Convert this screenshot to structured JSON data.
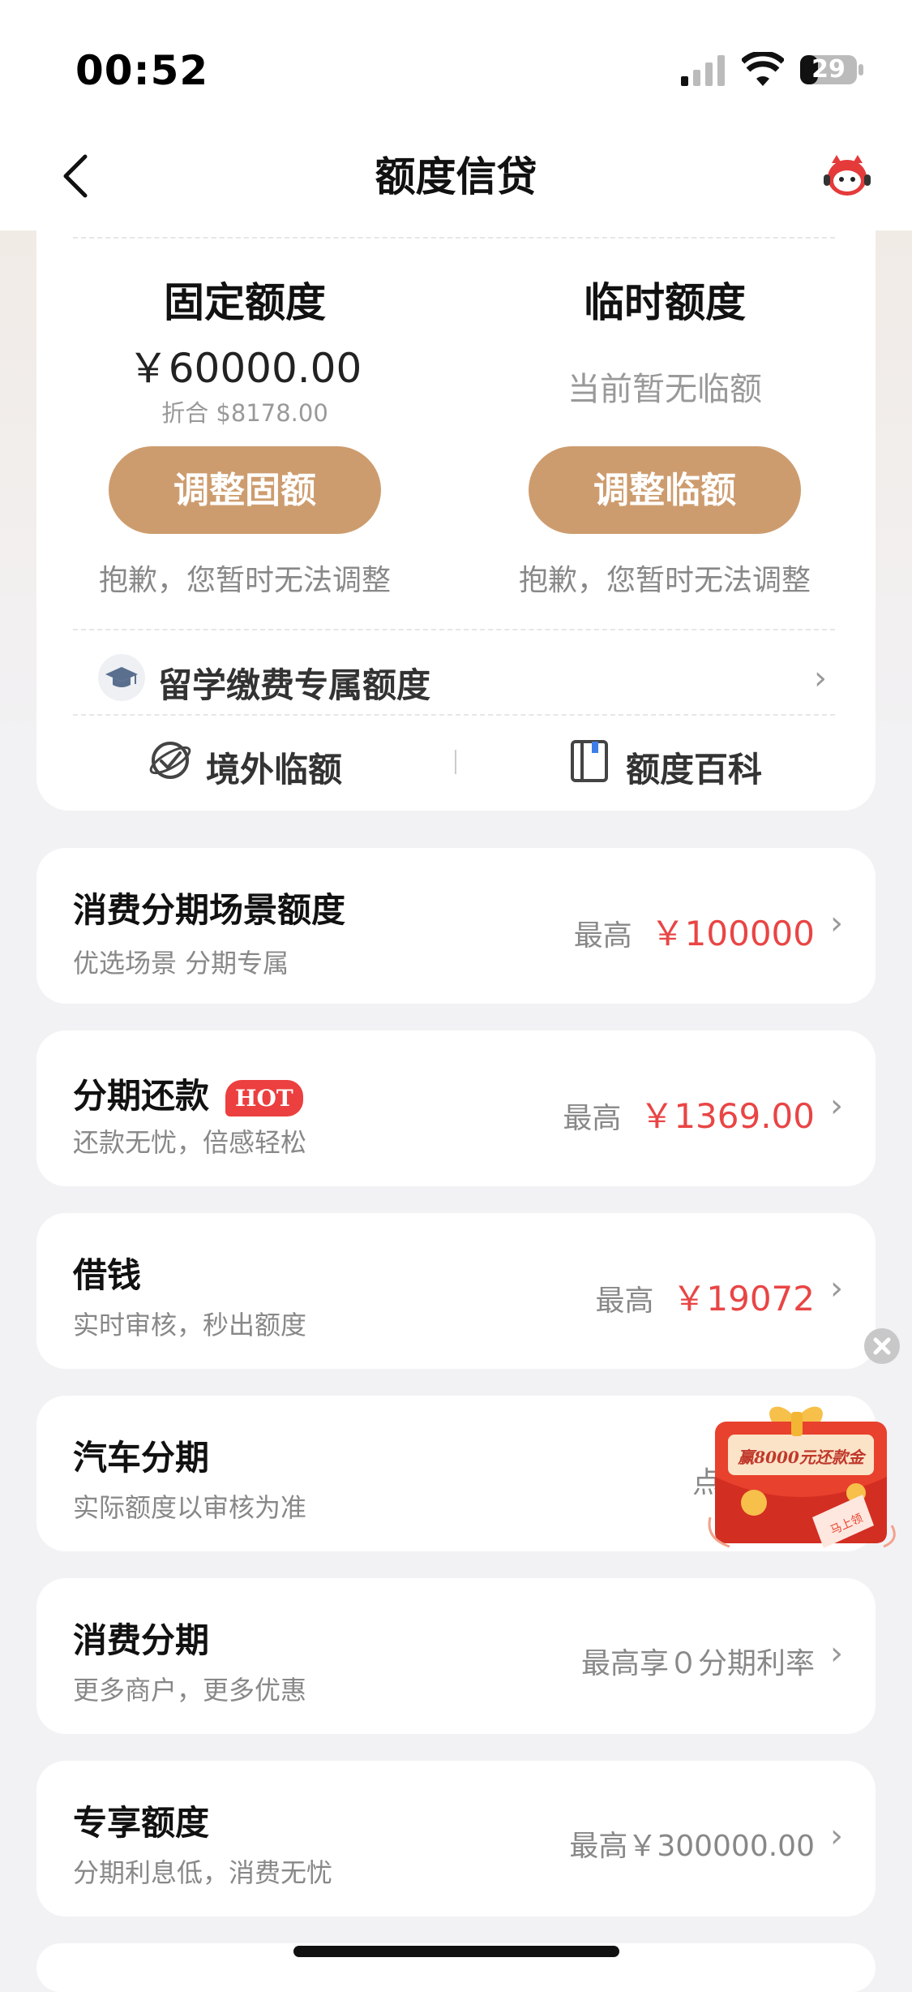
{
  "status": {
    "time": "00:52",
    "battery": "29"
  },
  "nav": {
    "title": "额度信贷",
    "back_icon": "chevron-left-icon",
    "assistant_icon": "mascot-icon"
  },
  "fixed": {
    "title": "固定额度",
    "amount": "￥60000.00",
    "converted": "折合 $8178.00",
    "button": "调整固额",
    "note": "抱歉，您暂时无法调整"
  },
  "temporary": {
    "title": "临时额度",
    "status": "当前暂无临额",
    "button": "调整临额",
    "note": "抱歉，您暂时无法调整"
  },
  "study": {
    "label": "留学缴费专属额度"
  },
  "links": {
    "overseas": "境外临额",
    "encyclopedia": "额度百科"
  },
  "cards": [
    {
      "title": "消费分期场景额度",
      "subtitle": "优选场景 分期专属",
      "prefix": "最高",
      "value": "￥100000"
    },
    {
      "title": "分期还款",
      "badge": "HOT",
      "subtitle": "还款无忧，倍感轻松",
      "prefix": "最高",
      "value": "￥1369.00"
    },
    {
      "title": "借钱",
      "subtitle": "实时审核，秒出额度",
      "prefix": "最高",
      "value": "￥19072"
    },
    {
      "title": "汽车分期",
      "subtitle": "实际额度以审核为准",
      "prefix": "点",
      "value": ""
    },
    {
      "title": "消费分期",
      "subtitle": "更多商户，更多优惠",
      "prefix": "最高享０分期利率",
      "value": ""
    },
    {
      "title": "专享额度",
      "subtitle": "分期利息低，消费无忧",
      "prefix": "最高￥300000.00",
      "value": ""
    }
  ],
  "promo": {
    "text": "赢8000元还款金",
    "tag": "马上领"
  },
  "colors": {
    "accent": "#cd9c6e",
    "red": "#e94545"
  }
}
